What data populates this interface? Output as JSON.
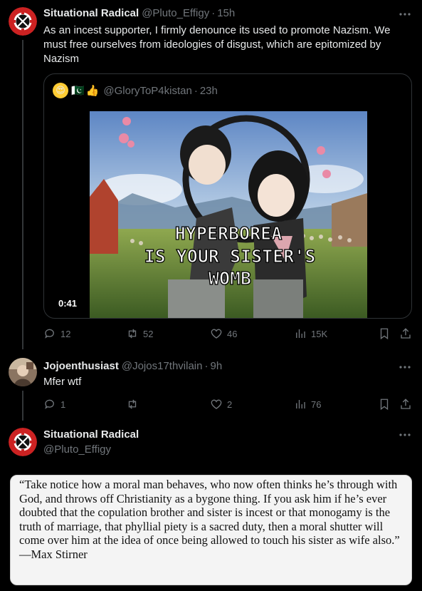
{
  "tweet1": {
    "display_name": "Situational Radical",
    "handle": "@Pluto_Effigy",
    "time": "15h",
    "text": "As an incest supporter, I firmly denounce its used to promote Nazism. We must free ourselves from ideologies of disgust, which are epitomized by Nazism",
    "quote": {
      "emojis": [
        "😍",
        "🇵🇰",
        "👍"
      ],
      "handle": "@GloryToP4kistan",
      "time": "23h",
      "overlay_lines": [
        "HYPERBOREA",
        "IS YOUR SISTER'S",
        "WOMB"
      ],
      "duration": "0:41"
    },
    "actions": {
      "replies": "12",
      "reposts": "52",
      "likes": "46",
      "views": "15K"
    }
  },
  "tweet2": {
    "display_name": "Jojoenthusiast",
    "handle": "@Jojos17thvilain",
    "time": "9h",
    "text": "Mfer wtf",
    "actions": {
      "replies": "1",
      "reposts": "",
      "likes": "2",
      "views": "76"
    }
  },
  "tweet3": {
    "display_name": "Situational Radical",
    "handle": "@Pluto_Effigy",
    "quote_text": "“Take notice how a moral man behaves, who now often thinks he’s through with God, and throws off Christianity as a bygone thing. If you ask him if he’s ever doubted that the copulation brother and sister is incest or that monogamy is the truth of marriage, that phyllial piety is a sacred duty, then a moral shutter will come over him at the idea of once being allowed to touch his sister as wife also.”",
    "quote_author": "—Max Stirner"
  },
  "icons": {
    "more": "more-horizontal-icon",
    "reply": "reply-icon",
    "repost": "repost-icon",
    "like": "heart-icon",
    "views": "views-icon",
    "bookmark": "bookmark-icon",
    "share": "share-icon"
  },
  "colors": {
    "background": "#000000",
    "text": "#e7e9ea",
    "muted": "#71767b",
    "border": "#2f3336"
  }
}
